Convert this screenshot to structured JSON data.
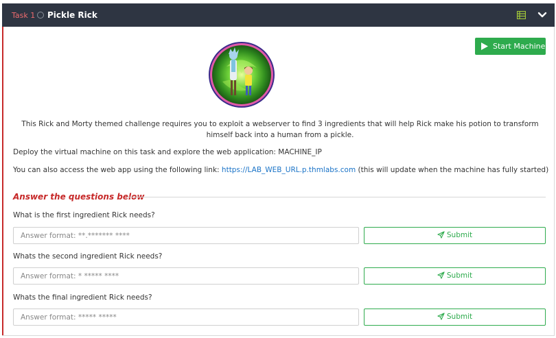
{
  "header": {
    "task_label": "Task 1",
    "title": "Pickle Rick",
    "icons": [
      "list-icon",
      "chevron-down-icon"
    ],
    "icon_color": "#a3c93a",
    "background": "#2e3542"
  },
  "start_button": {
    "label": "Start Machine",
    "icon": "play-icon",
    "color": "#2eab4d"
  },
  "logo": {
    "alt": "Rick and Morty portal"
  },
  "description": "This Rick and Morty themed challenge requires you to exploit a webserver to find 3 ingredients that will help Rick make his potion to transform himself back into a human from a pickle.",
  "deploy_text": "Deploy the virtual machine on this task and explore the web application: MACHINE_IP",
  "access": {
    "prefix": "You can also access the web app using the following link: ",
    "link": "https://LAB_WEB_URL.p.thmlabs.com",
    "suffix": " (this will update when the machine has fully started)"
  },
  "answer_section_title": "Answer the questions below",
  "questions": [
    {
      "question": "What is the first ingredient Rick needs?",
      "placeholder": "Answer format: **.******* ****",
      "submit_label": "Submit"
    },
    {
      "question": "Whats the second ingredient Rick needs?",
      "placeholder": "Answer format: * ***** ****",
      "submit_label": "Submit"
    },
    {
      "question": "Whats the final ingredient Rick needs?",
      "placeholder": "Answer format: ***** *****",
      "submit_label": "Submit"
    }
  ],
  "colors": {
    "accent_green": "#2eab4d",
    "accent_red": "#c62828",
    "link": "#1a73c7"
  }
}
